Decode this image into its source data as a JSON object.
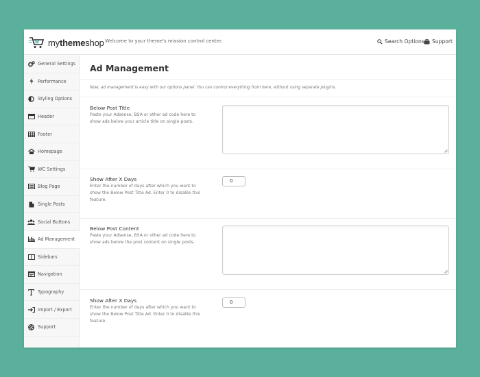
{
  "brand": {
    "logo_light": "my",
    "logo_bold": "theme",
    "logo_tail": "shop"
  },
  "header": {
    "tagline": "Welcome to your theme's mission control center.",
    "search_label": "Search Options",
    "support_label": "Support"
  },
  "sidebar": {
    "items": [
      {
        "label": "General Settings",
        "icon": "gears-icon"
      },
      {
        "label": "Performance",
        "icon": "bolt-icon"
      },
      {
        "label": "Styling Options",
        "icon": "adjust-icon"
      },
      {
        "label": "Header",
        "icon": "header-icon"
      },
      {
        "label": "Footer",
        "icon": "table-icon"
      },
      {
        "label": "Homepage",
        "icon": "home-icon"
      },
      {
        "label": "WC Settings",
        "icon": "cart-icon"
      },
      {
        "label": "Blog Page",
        "icon": "list-icon"
      },
      {
        "label": "Single Posts",
        "icon": "file-icon"
      },
      {
        "label": "Social Buttons",
        "icon": "users-icon"
      },
      {
        "label": "Ad Management",
        "icon": "bar-chart-icon",
        "active": true
      },
      {
        "label": "Sidebars",
        "icon": "columns-icon"
      },
      {
        "label": "Navigation",
        "icon": "navigation-icon"
      },
      {
        "label": "Typography",
        "icon": "text-icon"
      },
      {
        "label": "Import / Export",
        "icon": "sign-in-icon"
      },
      {
        "label": "Support",
        "icon": "lifebuoy-icon"
      }
    ]
  },
  "main": {
    "title": "Ad Management",
    "intro": "Now, ad management is easy with our options panel. You can control everything from here, without using separate plugins.",
    "options": [
      {
        "title": "Below Post Title",
        "desc": "Paste your Adsense, BSA or other ad code here to show ads below your article title on single posts.",
        "type": "textarea",
        "value": ""
      },
      {
        "title": "Show After X Days",
        "desc": "Enter the number of days after which you want to show the Below Post Title Ad. Enter 0 to disable this feature.",
        "type": "number",
        "value": "0"
      },
      {
        "title": "Below Post Content",
        "desc": "Paste your Adsense, BSA or other ad code here to show ads below the post content on single posts.",
        "type": "textarea",
        "value": ""
      },
      {
        "title": "Show After X Days",
        "desc": "Enter the number of days after which you want to show the Below Post Title Ad. Enter 0 to disable this feature.",
        "type": "number",
        "value": "0"
      }
    ]
  },
  "colors": {
    "background": "#5bb09c",
    "panel": "#ffffff",
    "sidebar": "#f7f7f7",
    "logo_accent": "#2fb0a3"
  }
}
